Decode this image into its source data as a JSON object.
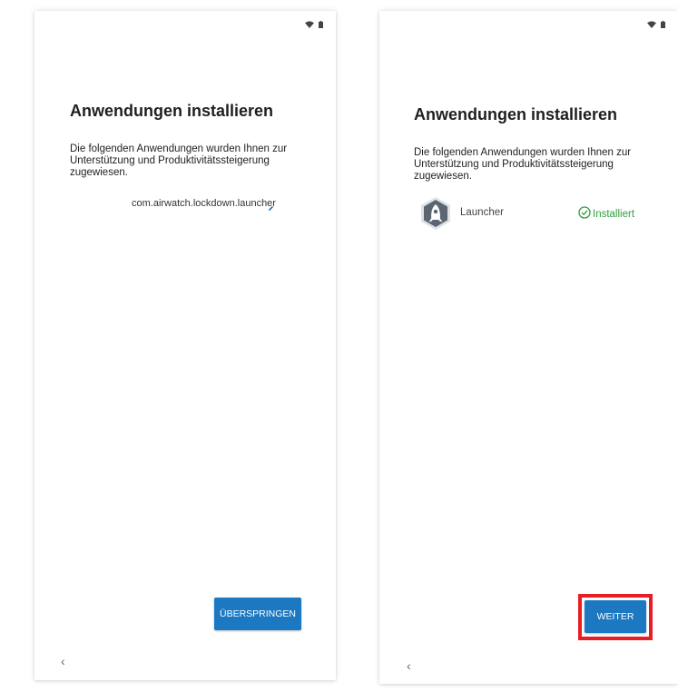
{
  "left_screen": {
    "title": "Anwendungen installieren",
    "description": "Die folgenden Anwendungen wurden Ihnen zur Unterstützung und Produktivitätssteigerung zugewiesen.",
    "app_identifier": "com.airwatch.lockdown.launcher",
    "skip_label": "ÜBERSPRINGEN",
    "back_glyph": "‹",
    "icons": [
      "wifi-icon",
      "battery-icon",
      "edit-icon",
      "back-icon"
    ]
  },
  "right_screen": {
    "title": "Anwendungen installieren",
    "description": "Die folgenden Anwendungen wurden Ihnen zur Unterstützung und Produktivitätssteigerung zugewiesen.",
    "app": {
      "name": "Launcher",
      "status": "Installiert"
    },
    "next_label": "WEITER",
    "back_glyph": "‹",
    "icons": [
      "wifi-icon",
      "battery-icon",
      "launcher-app-icon",
      "check-circle-icon",
      "back-icon"
    ]
  },
  "colors": {
    "button": "#1c78c0",
    "status_success": "#2e9e3f",
    "highlight": "#e81e25"
  }
}
